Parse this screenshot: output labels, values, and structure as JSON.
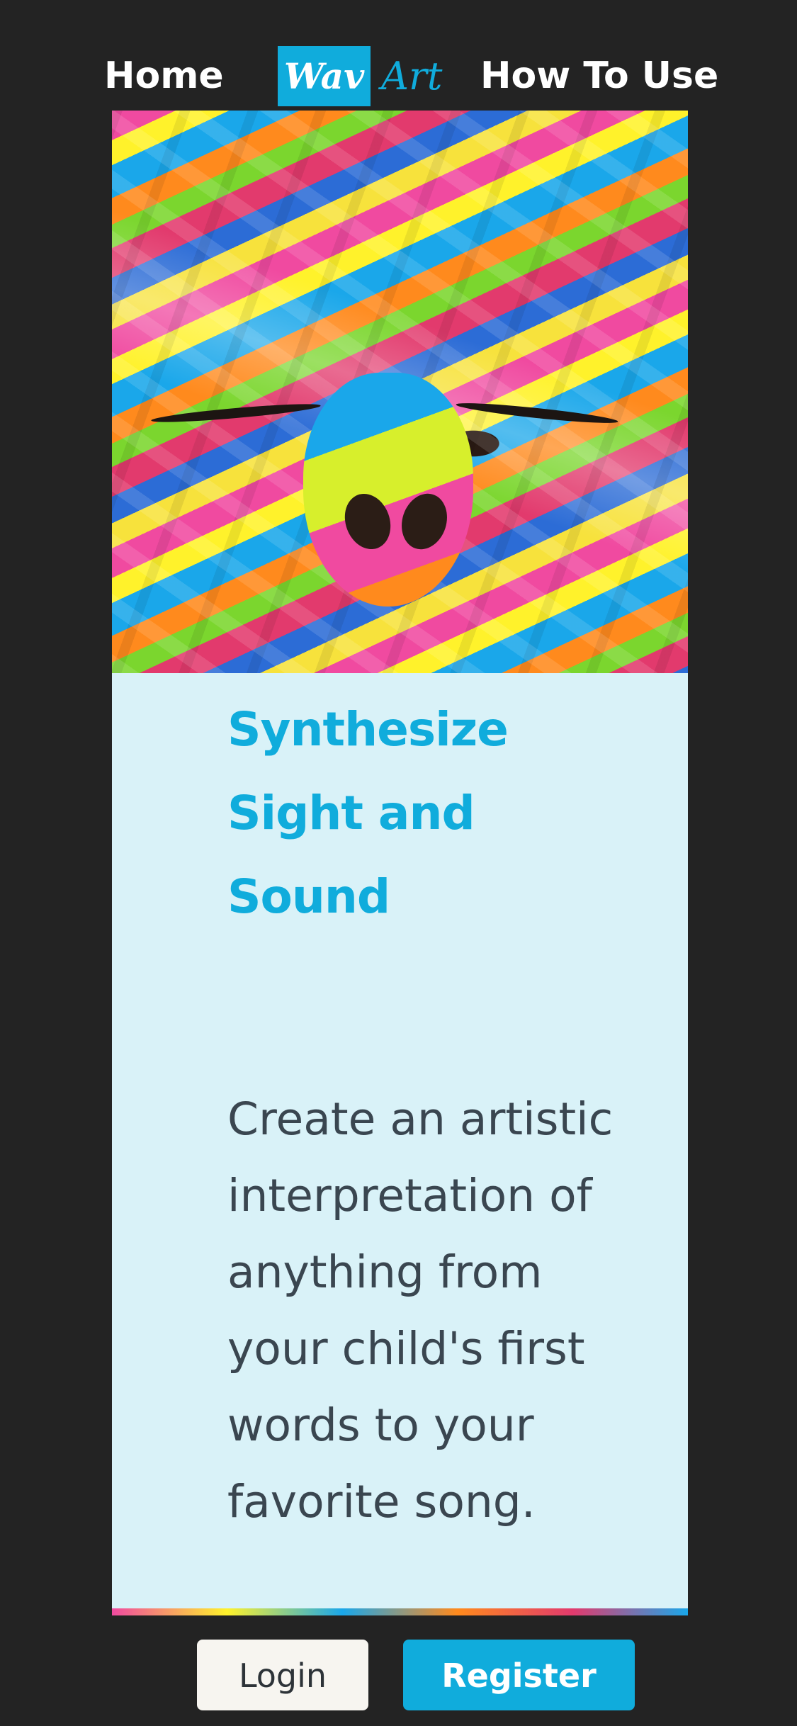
{
  "nav": {
    "home_label": "Home",
    "how_to_use_label": "How To Use",
    "logo": {
      "part1": "Wav",
      "part2": "Art"
    }
  },
  "hero": {
    "headline": "Synthesize Sight and Sound",
    "description": "Create an artistic interpretation of anything from your child's first words to your favorite song."
  },
  "actions": {
    "login_label": "Login",
    "register_label": "Register"
  },
  "colors": {
    "background": "#232323",
    "accent": "#10acdc",
    "card": "#d9f2f8",
    "body_text": "#3a4650"
  }
}
